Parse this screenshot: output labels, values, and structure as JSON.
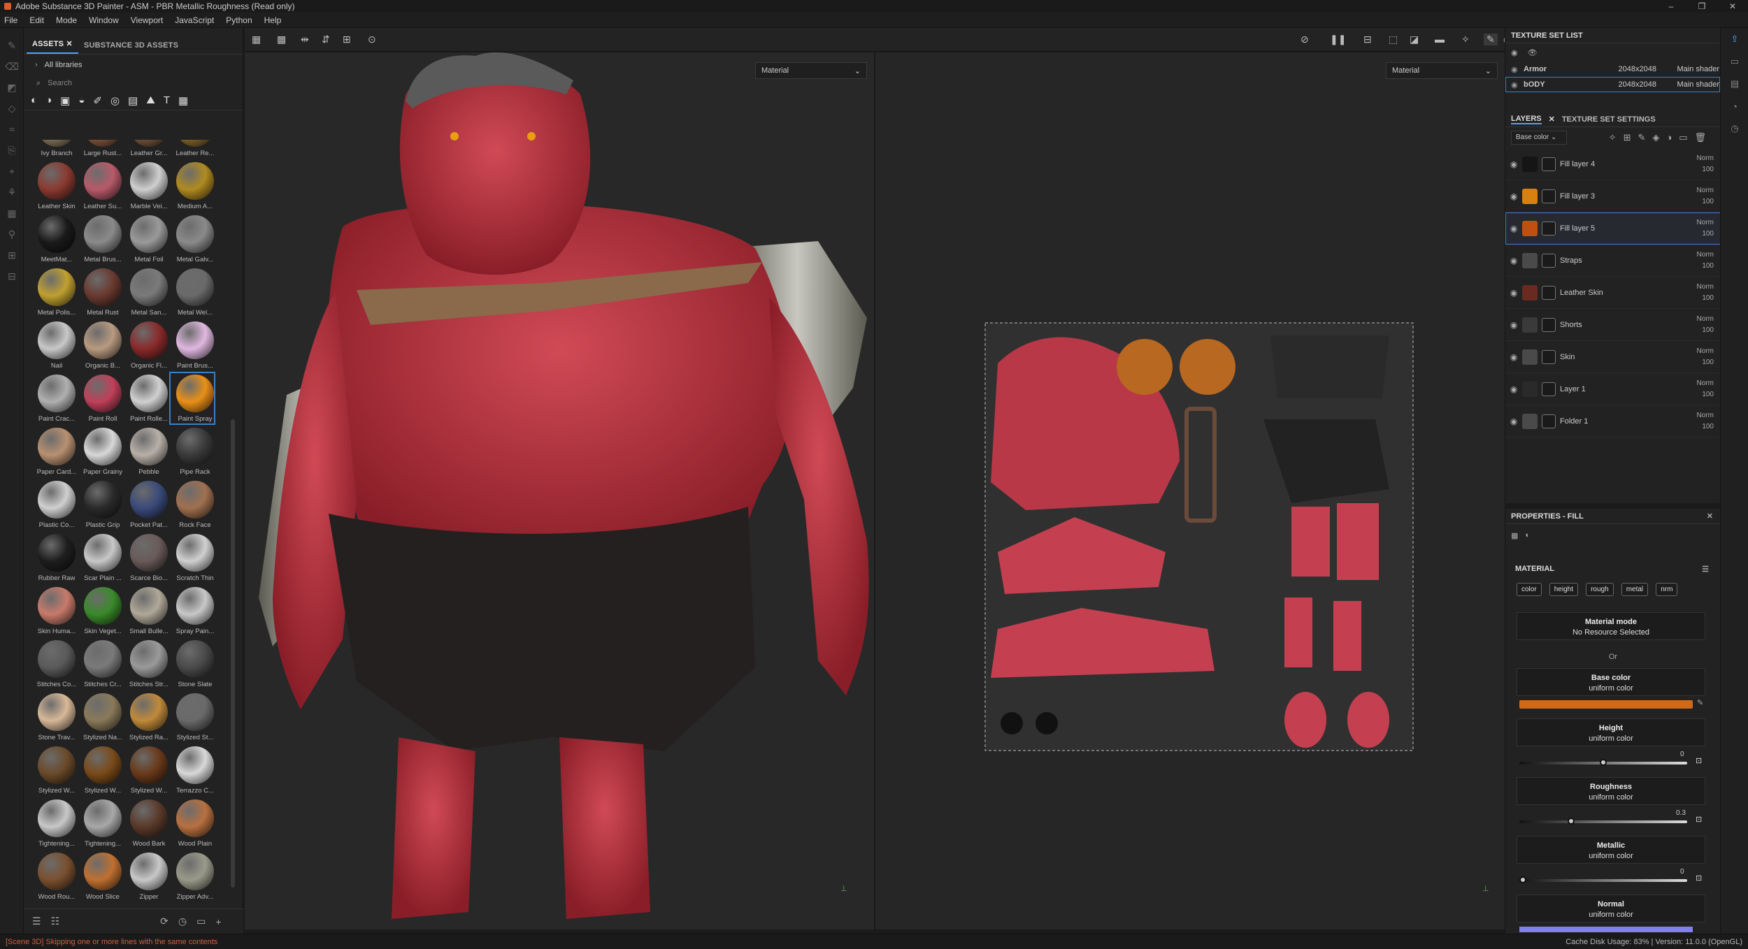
{
  "window": {
    "title": "Adobe Substance 3D Painter - ASM - PBR Metallic Roughness (Read only)",
    "controls": [
      "–",
      "❐",
      "✕"
    ]
  },
  "menu": [
    "File",
    "Edit",
    "Mode",
    "Window",
    "Viewport",
    "JavaScript",
    "Python",
    "Help"
  ],
  "assets": {
    "tabs": [
      "ASSETS",
      "SUBSTANCE 3D ASSETS"
    ],
    "breadcrumb": "All libraries",
    "search_placeholder": "Search",
    "items": [
      {
        "label": "Ivy Branch",
        "color": "#8a7a60"
      },
      {
        "label": "Large Rust...",
        "color": "#8a5a40"
      },
      {
        "label": "Leather Gr...",
        "color": "#7a5a40"
      },
      {
        "label": "Leather Re...",
        "color": "#8a6a30"
      },
      {
        "label": "Leather Skin",
        "color": "#8a3a30"
      },
      {
        "label": "Leather Su...",
        "color": "#b85a6a"
      },
      {
        "label": "Marble Vei...",
        "color": "#cfcfcf"
      },
      {
        "label": "Medium A...",
        "color": "#b08a20"
      },
      {
        "label": "MeetMat...",
        "color": "#1a1a1a"
      },
      {
        "label": "Metal Brus...",
        "color": "#8a8a8a"
      },
      {
        "label": "Metal Foil",
        "color": "#9a9a9a"
      },
      {
        "label": "Metal Galv...",
        "color": "#8a8a8a"
      },
      {
        "label": "Metal Polis...",
        "color": "#c0a030"
      },
      {
        "label": "Metal Rust",
        "color": "#6a3a30"
      },
      {
        "label": "Metal San...",
        "color": "#7a7a7a"
      },
      {
        "label": "Metal Wel...",
        "color": "#6a6a6a"
      },
      {
        "label": "Nail",
        "color": "#c8c8c8"
      },
      {
        "label": "Organic B...",
        "color": "#b89a80"
      },
      {
        "label": "Organic Fl...",
        "color": "#8a2a2a"
      },
      {
        "label": "Paint Brus...",
        "color": "#e0b8e0"
      },
      {
        "label": "Paint Crac...",
        "color": "#b0b0b0"
      },
      {
        "label": "Paint Roll",
        "color": "#c0405a"
      },
      {
        "label": "Paint Rolle...",
        "color": "#d0d0d0"
      },
      {
        "label": "Paint Spray",
        "color": "#e89018"
      },
      {
        "label": "Paper Card...",
        "color": "#b89070"
      },
      {
        "label": "Paper Grainy",
        "color": "#d8d8d8"
      },
      {
        "label": "Pebble",
        "color": "#b8b0a8"
      },
      {
        "label": "Pipe Rack",
        "color": "#3a3a3a"
      },
      {
        "label": "Plastic Co...",
        "color": "#d0d0d0"
      },
      {
        "label": "Plastic Grip",
        "color": "#2a2a2a"
      },
      {
        "label": "Pocket Pat...",
        "color": "#3a4a7a"
      },
      {
        "label": "Rock Face",
        "color": "#a07050"
      },
      {
        "label": "Rubber Raw",
        "color": "#1e1e1e"
      },
      {
        "label": "Scar Plain ...",
        "color": "#c8c8c8"
      },
      {
        "label": "Scarce Bio...",
        "color": "#6a5a5a"
      },
      {
        "label": "Scratch Thin",
        "color": "#d0d0d0"
      },
      {
        "label": "Skin Huma...",
        "color": "#c87a6a"
      },
      {
        "label": "Skin Veget...",
        "color": "#3a8a2a"
      },
      {
        "label": "Small Bulle...",
        "color": "#b0a898"
      },
      {
        "label": "Spray Pain...",
        "color": "#c8c8c8"
      },
      {
        "label": "Stitches Co...",
        "color": "#5a5a5a"
      },
      {
        "label": "Stitches Cr...",
        "color": "#7a7a7a"
      },
      {
        "label": "Stitches Str...",
        "color": "#9a9a9a"
      },
      {
        "label": "Stone Slate",
        "color": "#4a4a4a"
      },
      {
        "label": "Stone Trav...",
        "color": "#d8b898"
      },
      {
        "label": "Stylized Na...",
        "color": "#8a7a5a"
      },
      {
        "label": "Stylized Ra...",
        "color": "#c08a3a"
      },
      {
        "label": "Stylized St...",
        "color": "#6a6a6a"
      },
      {
        "label": "Stylized W...",
        "color": "#6a4a2a"
      },
      {
        "label": "Stylized W...",
        "color": "#7a4a1a"
      },
      {
        "label": "Stylized W...",
        "color": "#6a3a1a"
      },
      {
        "label": "Terrazzo C...",
        "color": "#d8d8d8"
      },
      {
        "label": "Tightening...",
        "color": "#c8c8c8"
      },
      {
        "label": "Tightening...",
        "color": "#a8a8a8"
      },
      {
        "label": "Wood Bark",
        "color": "#5a3a2a"
      },
      {
        "label": "Wood Plain",
        "color": "#b87040"
      },
      {
        "label": "Wood Rou...",
        "color": "#7a5030"
      },
      {
        "label": "Wood Slice",
        "color": "#c07030"
      },
      {
        "label": "Zipper",
        "color": "#c8c8c8"
      },
      {
        "label": "Zipper Adv...",
        "color": "#9a9a8a"
      }
    ],
    "selected_item": "Paint Spray"
  },
  "viewport": {
    "mode_left": "Material",
    "mode_right": "Material"
  },
  "texture_set_list": {
    "title": "TEXTURE SET LIST",
    "sets": [
      {
        "name": "Armor",
        "size": "2048x2048",
        "shader": "Main shader"
      },
      {
        "name": "bODY",
        "size": "2048x2048",
        "shader": "Main shader"
      }
    ]
  },
  "layers": {
    "tabs": [
      "LAYERS",
      "TEXTURE SET SETTINGS"
    ],
    "channel": "Base color",
    "items": [
      {
        "name": "Fill layer 4",
        "blend": "Norm",
        "opacity": "100",
        "thumb": "#151515",
        "selected": false
      },
      {
        "name": "Fill layer 3",
        "blend": "Norm",
        "opacity": "100",
        "thumb": "#d88010",
        "selected": false
      },
      {
        "name": "Fill layer 5",
        "blend": "Norm",
        "opacity": "100",
        "thumb": "#c05010",
        "selected": true
      },
      {
        "name": "Straps",
        "blend": "Norm",
        "opacity": "100",
        "thumb": "#4a4a4a",
        "selected": false
      },
      {
        "name": "Leather Skin",
        "blend": "Norm",
        "opacity": "100",
        "thumb": "#6a2a20",
        "selected": false
      },
      {
        "name": "Shorts",
        "blend": "Norm",
        "opacity": "100",
        "thumb": "#3a3a3a",
        "selected": false
      },
      {
        "name": "Skin",
        "blend": "Norm",
        "opacity": "100",
        "thumb": "#4a4a4a",
        "selected": false
      },
      {
        "name": "Layer 1",
        "blend": "Norm",
        "opacity": "100",
        "thumb": "#2a2a2a",
        "selected": false
      },
      {
        "name": "Folder 1",
        "blend": "Norm",
        "opacity": "100",
        "thumb": "#4a4a4a",
        "selected": false
      }
    ]
  },
  "properties": {
    "title": "PROPERTIES - FILL",
    "section": "MATERIAL",
    "channels": [
      "color",
      "height",
      "rough",
      "metal",
      "nrm"
    ],
    "material_mode": {
      "title": "Material mode",
      "value": "No Resource Selected"
    },
    "or_label": "Or",
    "base_color": {
      "title": "Base color",
      "value": "uniform color",
      "color": "#d06a18"
    },
    "height": {
      "title": "Height",
      "value": "uniform color",
      "number": "0",
      "fraction": 0.5
    },
    "roughness": {
      "title": "Roughness",
      "value": "uniform color",
      "number": "0.3",
      "fraction": 0.3
    },
    "metallic": {
      "title": "Metallic",
      "value": "uniform color",
      "number": "0",
      "fraction": 0.0
    },
    "normal": {
      "title": "Normal",
      "value": "uniform color",
      "color": "#8080f0"
    }
  },
  "status": {
    "message": "[Scene 3D] Skipping one or more lines with the same contents",
    "cache": "Cache Disk Usage:  83% | Version: 11.0.0 (OpenGL)"
  }
}
